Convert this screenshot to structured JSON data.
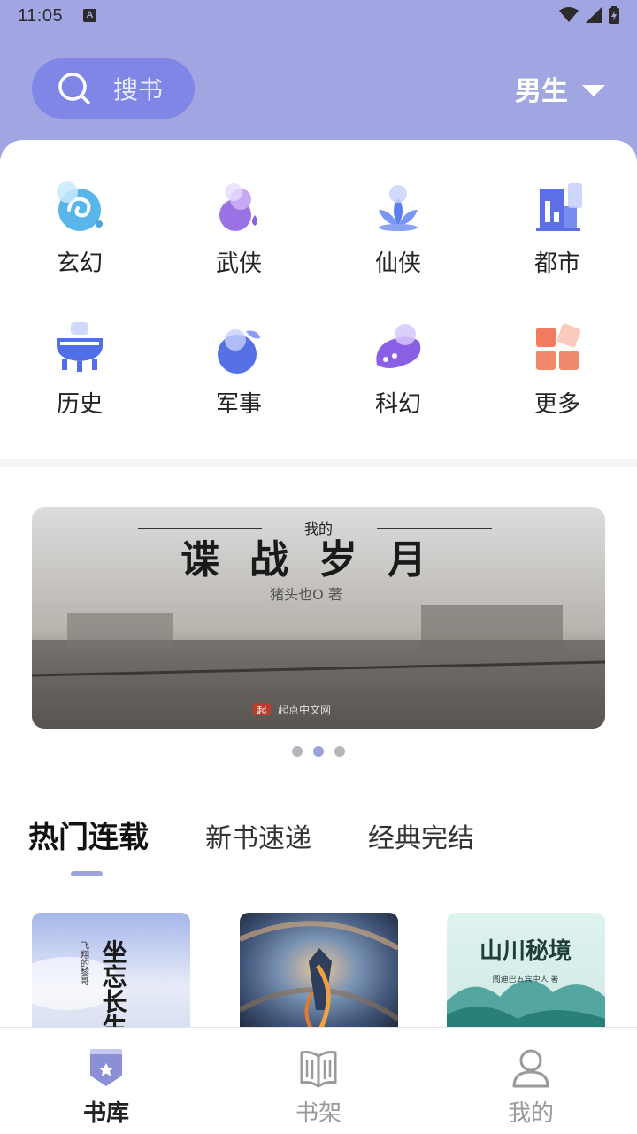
{
  "status_bar": {
    "time": "11:05",
    "a_badge": "A"
  },
  "header": {
    "search_placeholder": "搜书",
    "gender_label": "男生"
  },
  "categories": [
    {
      "label": "玄幻",
      "icon": "swirl-icon"
    },
    {
      "label": "武侠",
      "icon": "gourd-icon"
    },
    {
      "label": "仙侠",
      "icon": "lotus-icon"
    },
    {
      "label": "都市",
      "icon": "buildings-icon"
    },
    {
      "label": "历史",
      "icon": "ding-cauldron-icon"
    },
    {
      "label": "军事",
      "icon": "grenade-icon"
    },
    {
      "label": "科幻",
      "icon": "planet-icon"
    },
    {
      "label": "更多",
      "icon": "grid-icon"
    }
  ],
  "banner": {
    "small_title": "我的",
    "title": "谍战岁月",
    "author_line": "猪头也O 著",
    "publisher": "起点中文网",
    "publisher_badge": "起"
  },
  "carousel": {
    "count": 3,
    "active_index": 1
  },
  "tabs": [
    {
      "label": "热门连载",
      "active": true
    },
    {
      "label": "新书速递",
      "active": false
    },
    {
      "label": "经典完结",
      "active": false
    }
  ],
  "books": [
    {
      "cover_title": "坐忘长生",
      "cover_author": "飞翔的黎哥"
    },
    {
      "cover_title": "",
      "cover_author": ""
    },
    {
      "cover_title": "山川秘境",
      "cover_author": "阁迪巴五宾中人 著"
    }
  ],
  "bottom_nav": [
    {
      "label": "书库",
      "active": true
    },
    {
      "label": "书架",
      "active": false
    },
    {
      "label": "我的",
      "active": false
    }
  ],
  "colors": {
    "accent": "#a1a6e2",
    "search_bg": "#7f86e6",
    "nav_active": "#8a8fd6"
  }
}
